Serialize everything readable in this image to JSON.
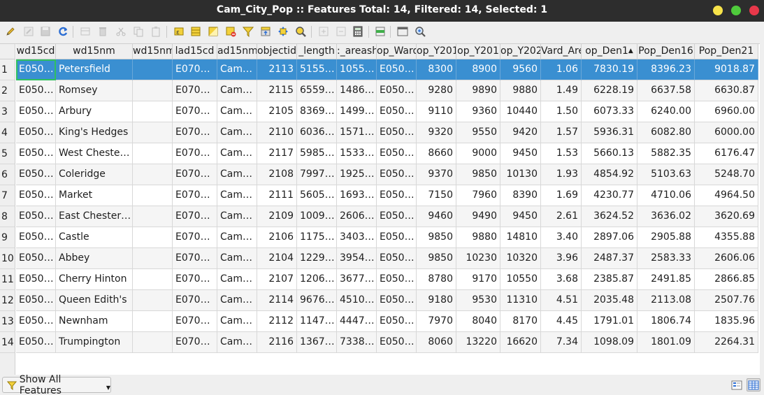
{
  "window": {
    "title": "Cam_City_Pop :: Features Total: 14, Filtered: 14, Selected: 1"
  },
  "toolbar": {
    "icons": [
      "pencil-icon",
      "multi-edit-icon",
      "save-icon",
      "reload-icon",
      "add-feature-icon",
      "delete-feature-icon",
      "cut-icon",
      "copy-icon",
      "paste-icon",
      "select-by-expression-icon",
      "select-all-icon",
      "invert-selection-icon",
      "deselect-all-icon",
      "filter-icon",
      "move-selection-to-top-icon",
      "pan-to-selection-icon",
      "zoom-to-selection-icon",
      "new-field-icon",
      "delete-field-icon",
      "field-calculator-icon",
      "conditional-formatting-icon",
      "dock-icon",
      "actions-icon"
    ]
  },
  "table": {
    "columns": [
      "wd15cd",
      "wd15nm",
      "wd15nmw",
      "lad15cd",
      "ad15nm",
      "objectid",
      "_length",
      ":_areash",
      "op_Ward",
      "op_Y201",
      "op_Y201",
      "op_Y202",
      "Vard_Are",
      "op_Den1",
      "Pop_Den16",
      "Pop_Den21"
    ],
    "sorted_column_index": 13,
    "sort_indicator": "▲",
    "selected_row_index": 0,
    "rows": [
      {
        "n": "1",
        "c": [
          "E050…",
          "Petersfield",
          "",
          "E070…",
          "Cam…",
          "2113",
          "5155…",
          "1055…",
          "E050…",
          "8300",
          "8900",
          "9560",
          "1.06",
          "7830.19",
          "8396.23",
          "9018.87"
        ]
      },
      {
        "n": "2",
        "c": [
          "E050…",
          "Romsey",
          "",
          "E070…",
          "Cam…",
          "2115",
          "6559…",
          "1486…",
          "E050…",
          "9280",
          "9890",
          "9880",
          "1.49",
          "6228.19",
          "6637.58",
          "6630.87"
        ]
      },
      {
        "n": "3",
        "c": [
          "E050…",
          "Arbury",
          "",
          "E070…",
          "Cam…",
          "2105",
          "8369…",
          "1499…",
          "E050…",
          "9110",
          "9360",
          "10440",
          "1.50",
          "6073.33",
          "6240.00",
          "6960.00"
        ]
      },
      {
        "n": "4",
        "c": [
          "E050…",
          "King's Hedges",
          "",
          "E070…",
          "Cam…",
          "2110",
          "6036…",
          "1571…",
          "E050…",
          "9320",
          "9550",
          "9420",
          "1.57",
          "5936.31",
          "6082.80",
          "6000.00"
        ]
      },
      {
        "n": "5",
        "c": [
          "E050…",
          "West Cheste…",
          "",
          "E070…",
          "Cam…",
          "2117",
          "5985…",
          "1533…",
          "E050…",
          "8660",
          "9000",
          "9450",
          "1.53",
          "5660.13",
          "5882.35",
          "6176.47"
        ]
      },
      {
        "n": "6",
        "c": [
          "E050…",
          "Coleridge",
          "",
          "E070…",
          "Cam…",
          "2108",
          "7997…",
          "1925…",
          "E050…",
          "9370",
          "9850",
          "10130",
          "1.93",
          "4854.92",
          "5103.63",
          "5248.70"
        ]
      },
      {
        "n": "7",
        "c": [
          "E050…",
          "Market",
          "",
          "E070…",
          "Cam…",
          "2111",
          "5605…",
          "1693…",
          "E050…",
          "7150",
          "7960",
          "8390",
          "1.69",
          "4230.77",
          "4710.06",
          "4964.50"
        ]
      },
      {
        "n": "8",
        "c": [
          "E050…",
          "East Chester…",
          "",
          "E070…",
          "Cam…",
          "2109",
          "1009…",
          "2606…",
          "E050…",
          "9460",
          "9490",
          "9450",
          "2.61",
          "3624.52",
          "3636.02",
          "3620.69"
        ]
      },
      {
        "n": "9",
        "c": [
          "E050…",
          "Castle",
          "",
          "E070…",
          "Cam…",
          "2106",
          "1175…",
          "3403…",
          "E050…",
          "9850",
          "9880",
          "14810",
          "3.40",
          "2897.06",
          "2905.88",
          "4355.88"
        ]
      },
      {
        "n": "10",
        "c": [
          "E050…",
          "Abbey",
          "",
          "E070…",
          "Cam…",
          "2104",
          "1229…",
          "3954…",
          "E050…",
          "9850",
          "10230",
          "10320",
          "3.96",
          "2487.37",
          "2583.33",
          "2606.06"
        ]
      },
      {
        "n": "11",
        "c": [
          "E050…",
          "Cherry Hinton",
          "",
          "E070…",
          "Cam…",
          "2107",
          "1206…",
          "3677…",
          "E050…",
          "8780",
          "9170",
          "10550",
          "3.68",
          "2385.87",
          "2491.85",
          "2866.85"
        ]
      },
      {
        "n": "12",
        "c": [
          "E050…",
          "Queen Edith's",
          "",
          "E070…",
          "Cam…",
          "2114",
          "9676…",
          "4510…",
          "E050…",
          "9180",
          "9530",
          "11310",
          "4.51",
          "2035.48",
          "2113.08",
          "2507.76"
        ]
      },
      {
        "n": "13",
        "c": [
          "E050…",
          "Newnham",
          "",
          "E070…",
          "Cam…",
          "2112",
          "1147…",
          "4447…",
          "E050…",
          "7970",
          "8040",
          "8170",
          "4.45",
          "1791.01",
          "1806.74",
          "1835.96"
        ]
      },
      {
        "n": "14",
        "c": [
          "E050…",
          "Trumpington",
          "",
          "E070…",
          "Cam…",
          "2116",
          "1367…",
          "7338…",
          "E050…",
          "8060",
          "13220",
          "16620",
          "7.34",
          "1098.09",
          "1801.09",
          "2264.31"
        ]
      }
    ]
  },
  "footer": {
    "filter_label": "Show All Features"
  },
  "colors": {
    "selection": "#3a8fd1",
    "focus_outline": "#30c060",
    "titlebar": "#2d2d2d"
  }
}
